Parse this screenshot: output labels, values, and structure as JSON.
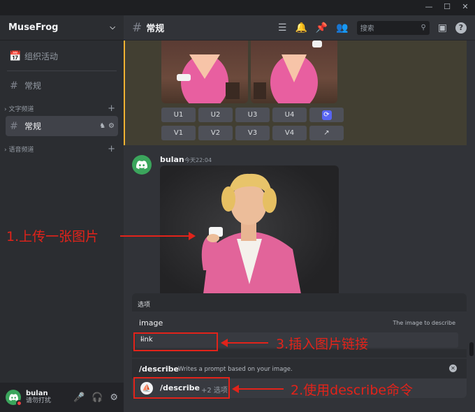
{
  "window": {
    "minimize": "—",
    "maximize": "☐",
    "close": "✕"
  },
  "server": {
    "name": "MuseFrog",
    "events_label": "组织活动",
    "channel_top": "常规"
  },
  "sidebar": {
    "text_category": "文字频道",
    "active_channel": "常规",
    "voice_category": "语音频道"
  },
  "user": {
    "name": "bulan",
    "status": "请勿打扰"
  },
  "channel": {
    "name": "常规",
    "search_placeholder": "搜索"
  },
  "grid_buttons": [
    "U1",
    "U2",
    "U3",
    "U4",
    "⟳",
    "V1",
    "V2",
    "V3",
    "V4",
    "↗"
  ],
  "message": {
    "author": "bulan",
    "time": "今天22:04"
  },
  "options": {
    "header": "选项",
    "option_name": "image",
    "option_desc": "The image to describe",
    "input_value": "link",
    "dash": "–"
  },
  "command": {
    "name": "/describe",
    "desc": "Writes a prompt based on your image.",
    "input_text": "/describe",
    "extra": "+2 选项"
  },
  "annotations": {
    "a1": "1.上传一张图片",
    "a2": "2.使用describe命令",
    "a3": "3.插入图片链接"
  },
  "colors": {
    "accent": "#5865f2",
    "annotation": "#e2231a",
    "highlight_border": "#f0b232"
  }
}
